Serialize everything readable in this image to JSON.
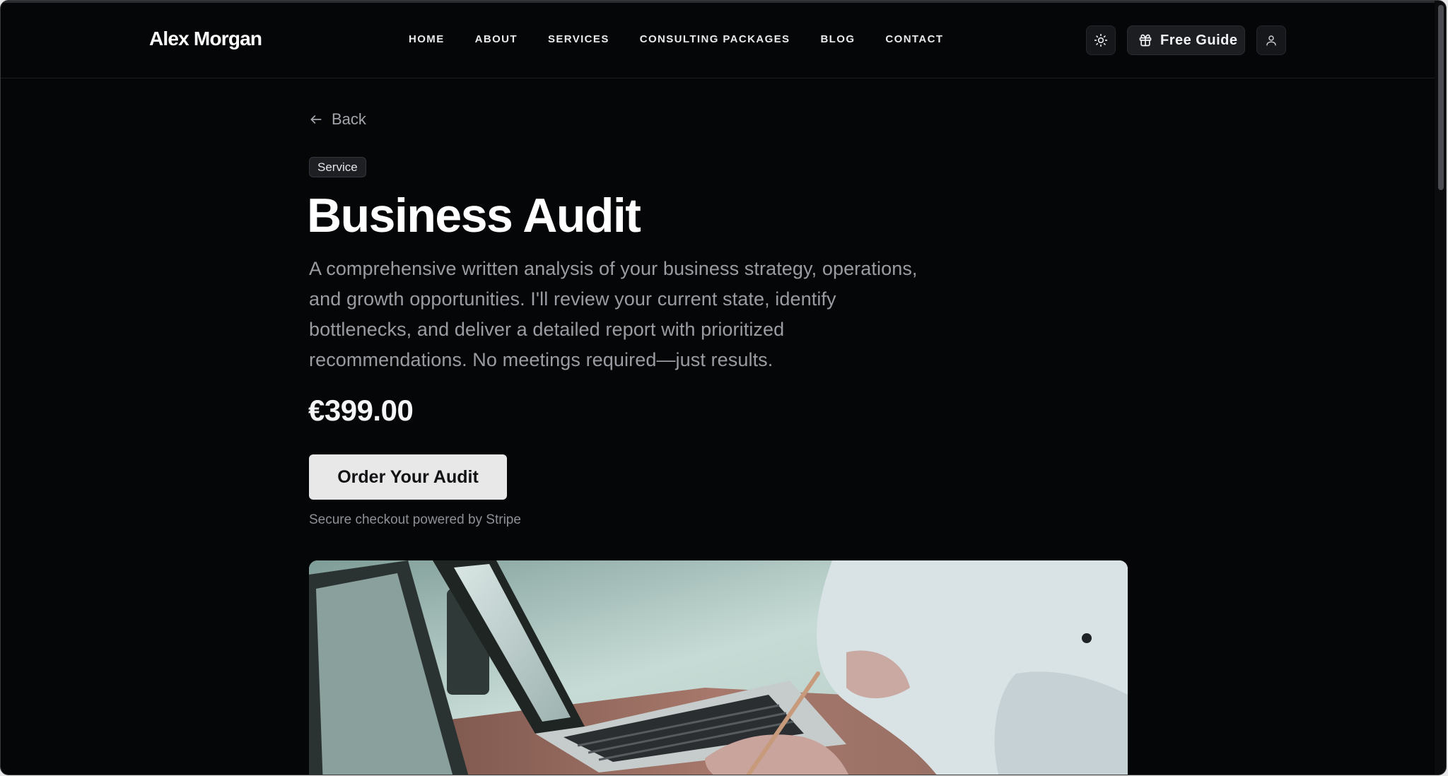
{
  "header": {
    "brand": "Alex Morgan",
    "nav": [
      "HOME",
      "ABOUT",
      "SERVICES",
      "CONSULTING PACKAGES",
      "BLOG",
      "CONTACT"
    ],
    "theme_toggle_icon": "sun-icon",
    "guide_label": "Free Guide",
    "guide_icon": "gift-icon",
    "account_icon": "user-icon"
  },
  "page": {
    "back_label": "Back",
    "badge": "Service",
    "title": "Business Audit",
    "description": "A comprehensive written analysis of your business strategy, operations, and growth opportunities. I'll review your current state, identify bottlenecks, and deliver a detailed report with prioritized recommendations. No meetings required—just results.",
    "price": "€399.00",
    "cta_label": "Order Your Audit",
    "secure_note": "Secure checkout powered by Stripe"
  },
  "colors": {
    "background": "#050608",
    "cta_background": "#e8e8e9",
    "muted_text": "#9a9ca2"
  }
}
